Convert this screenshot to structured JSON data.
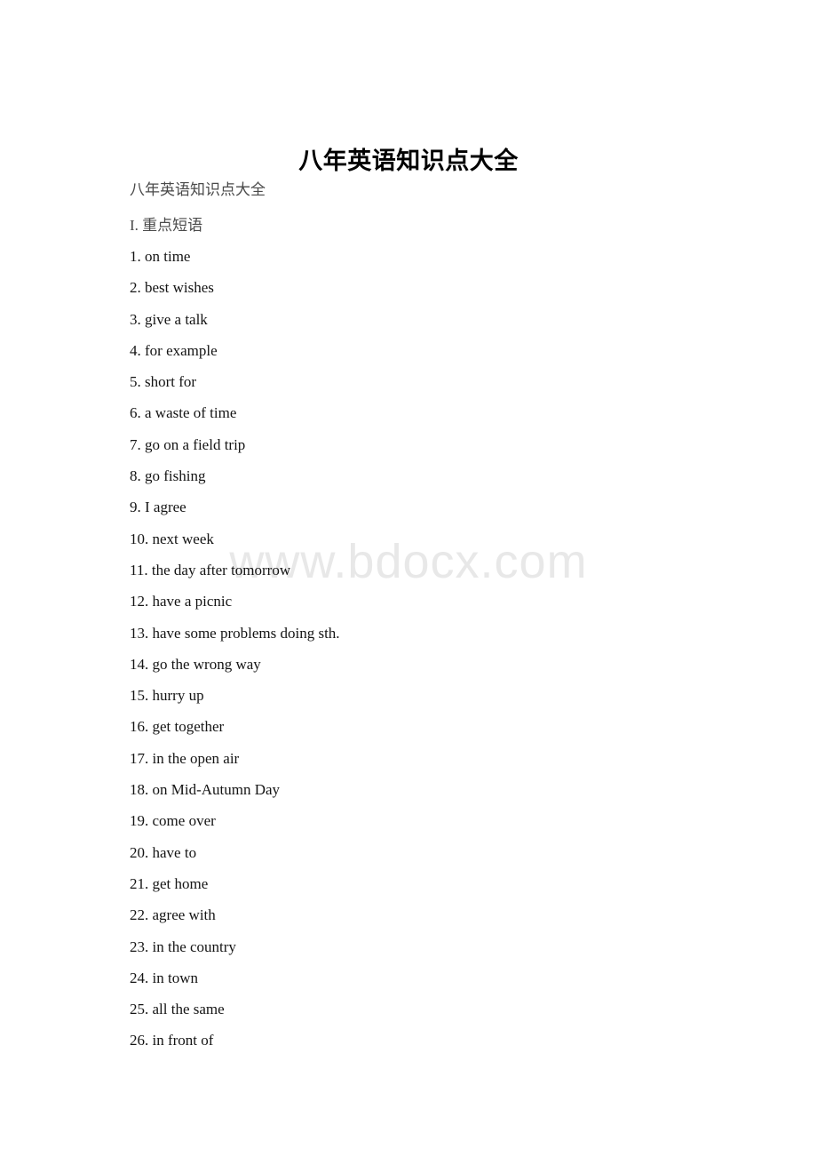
{
  "document": {
    "title": "八年英语知识点大全",
    "subtitle": "八年英语知识点大全",
    "section_heading": "I. 重点短语",
    "watermark": "www.bdocx.com",
    "colors": {
      "title_text": "#000000",
      "body_text": "#141414",
      "muted_text": "#4a4a4a",
      "watermark": "#e8e8e8",
      "page_background": "#ffffff"
    },
    "phrases": [
      {
        "number": "1.",
        "text": "on time"
      },
      {
        "number": "2.",
        "text": "best wishes"
      },
      {
        "number": "3.",
        "text": "give a talk"
      },
      {
        "number": "4.",
        "text": "for example"
      },
      {
        "number": "5.",
        "text": "short for"
      },
      {
        "number": "6.",
        "text": "a waste of time"
      },
      {
        "number": "7.",
        "text": "go on a field trip"
      },
      {
        "number": "8.",
        "text": "go fishing"
      },
      {
        "number": "9.",
        "text": "I agree"
      },
      {
        "number": "10.",
        "text": "next week"
      },
      {
        "number": "11.",
        "text": "the day after tomorrow"
      },
      {
        "number": "12.",
        "text": "have a picnic"
      },
      {
        "number": "13.",
        "text": "have some problems doing sth."
      },
      {
        "number": "14.",
        "text": "go the wrong way"
      },
      {
        "number": "15.",
        "text": "hurry up"
      },
      {
        "number": "16.",
        "text": "get together"
      },
      {
        "number": "17.",
        "text": "in the open air"
      },
      {
        "number": "18.",
        "text": "on Mid-Autumn Day"
      },
      {
        "number": "19.",
        "text": "come over"
      },
      {
        "number": "20.",
        "text": "have to"
      },
      {
        "number": "21.",
        "text": "get home"
      },
      {
        "number": "22.",
        "text": "agree with"
      },
      {
        "number": "23.",
        "text": "in the country"
      },
      {
        "number": "24.",
        "text": "in town"
      },
      {
        "number": "25.",
        "text": "all the same"
      },
      {
        "number": "26.",
        "text": "in front of"
      }
    ]
  }
}
